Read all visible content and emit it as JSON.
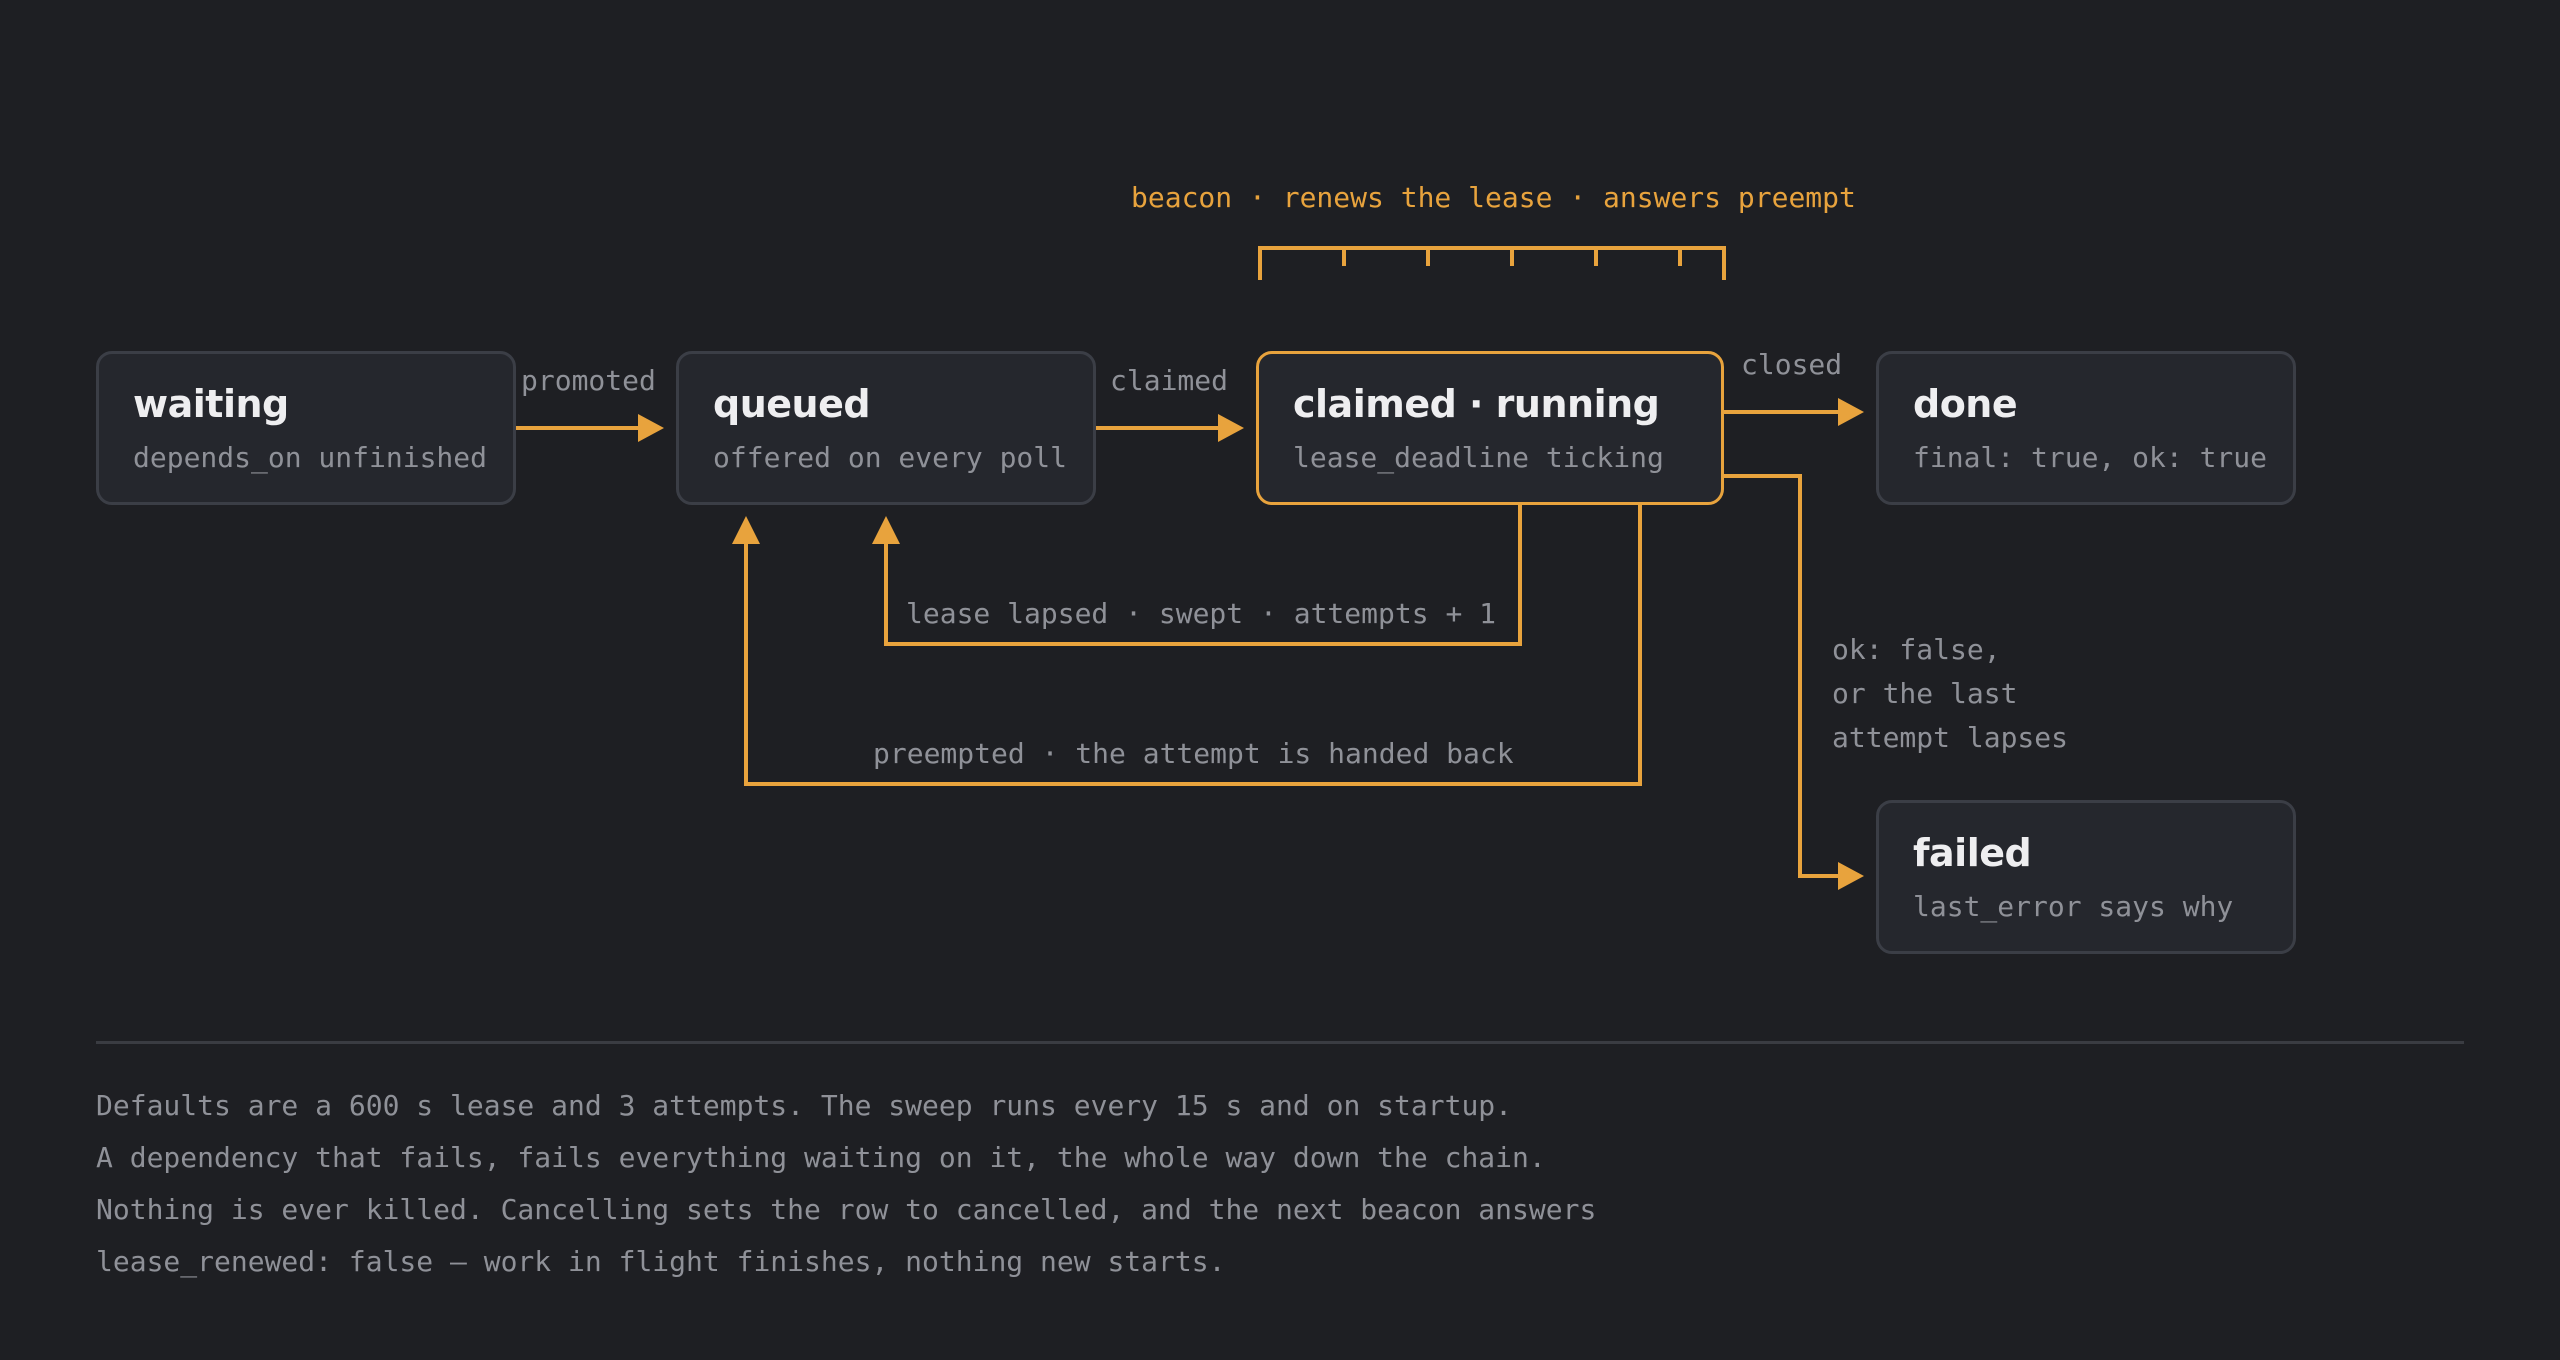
{
  "states": {
    "waiting": {
      "title": "waiting",
      "subtitle": "depends_on unfinished"
    },
    "queued": {
      "title": "queued",
      "subtitle": "offered on every poll"
    },
    "running": {
      "title": "claimed · running",
      "subtitle": "lease_deadline ticking"
    },
    "done": {
      "title": "done",
      "subtitle": "final: true, ok: true"
    },
    "failed": {
      "title": "failed",
      "subtitle": "last_error says why"
    }
  },
  "transitions": {
    "promoted": "promoted",
    "claimed": "claimed",
    "closed": "closed",
    "lease_lapsed": "lease lapsed · swept · attempts + 1",
    "preempted": "preempted · the attempt is handed back",
    "failed_reason": "ok: false,\nor the last\nattempt lapses"
  },
  "beacon": {
    "label": "beacon · renews the lease · answers preempt"
  },
  "notes": [
    "Defaults are a 600 s lease and 3 attempts. The sweep runs every 15 s and on startup.",
    "A dependency that fails, fails everything waiting on it, the whole way down the chain.",
    "Nothing is ever killed. Cancelling sets the row to cancelled, and the next beacon answers",
    "lease_renewed: false — work in flight finishes, nothing new starts."
  ],
  "colors": {
    "background": "#1e1f23",
    "node_fill": "#25272d",
    "node_border": "#3b3e46",
    "accent": "#e8a33d",
    "text": "#eeeef0",
    "muted": "#8f9198"
  }
}
